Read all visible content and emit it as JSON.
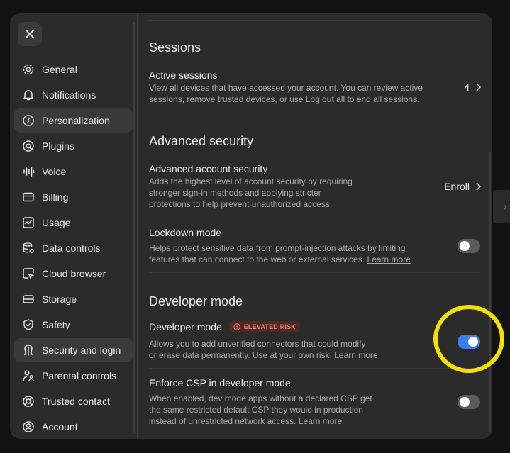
{
  "sidebar": {
    "close_label": "Close",
    "items": [
      {
        "label": "General",
        "icon": "gear-icon"
      },
      {
        "label": "Notifications",
        "icon": "bell-icon"
      },
      {
        "label": "Personalization",
        "icon": "personalization-icon"
      },
      {
        "label": "Plugins",
        "icon": "plugins-icon"
      },
      {
        "label": "Voice",
        "icon": "voice-wave-icon"
      },
      {
        "label": "Billing",
        "icon": "credit-card-icon"
      },
      {
        "label": "Usage",
        "icon": "usage-chart-icon"
      },
      {
        "label": "Data controls",
        "icon": "database-icon"
      },
      {
        "label": "Cloud browser",
        "icon": "cloud-browser-icon"
      },
      {
        "label": "Storage",
        "icon": "storage-icon"
      },
      {
        "label": "Safety",
        "icon": "shield-icon"
      },
      {
        "label": "Security and login",
        "icon": "security-icon"
      },
      {
        "label": "Parental controls",
        "icon": "parental-icon"
      },
      {
        "label": "Trusted contact",
        "icon": "lifebuoy-icon"
      },
      {
        "label": "Account",
        "icon": "account-icon"
      }
    ]
  },
  "sessions": {
    "title": "Sessions",
    "active_sessions": {
      "label": "Active sessions",
      "desc_line1": "View all devices that have accessed your account. You can review active",
      "desc_line2": "sessions, remove trusted devices, or use Log out all to end all sessions.",
      "count": "4"
    }
  },
  "advanced_security": {
    "title": "Advanced security",
    "account_security": {
      "label": "Advanced account security",
      "desc_line1": "Adds the highest level of account security by requiring",
      "desc_line2": "stronger sign-in methods and applying stricter",
      "desc_line3": "protections to help prevent unauthorized access.",
      "action": "Enroll"
    },
    "lockdown": {
      "label": "Lockdown mode",
      "desc_line1": "Helps protect sensitive data from prompt-injection attacks by limiting",
      "desc_line2": "features that can connect to the web or external services.",
      "learn_more": "Learn more",
      "enabled": false
    }
  },
  "developer": {
    "title": "Developer mode",
    "developer_mode": {
      "label": "Developer mode",
      "badge": "ELEVATED RISK",
      "desc_line1": "Allows you to add unverified connectors that could modify",
      "desc_line2": "or erase data permanently. Use at your own risk.",
      "learn_more": "Learn more",
      "enabled": true
    },
    "enforce_csp": {
      "label": "Enforce CSP in developer mode",
      "desc_line1": "When enabled, dev mode apps without a declared CSP get",
      "desc_line2": "the same restricted default CSP they would in production",
      "desc_line3": "instead of unrestricted network access.",
      "learn_more": "Learn more",
      "enabled": false
    }
  },
  "colors": {
    "accent": "#3a7fe8",
    "highlight": "#f4e000",
    "risk": "#f3806c"
  }
}
